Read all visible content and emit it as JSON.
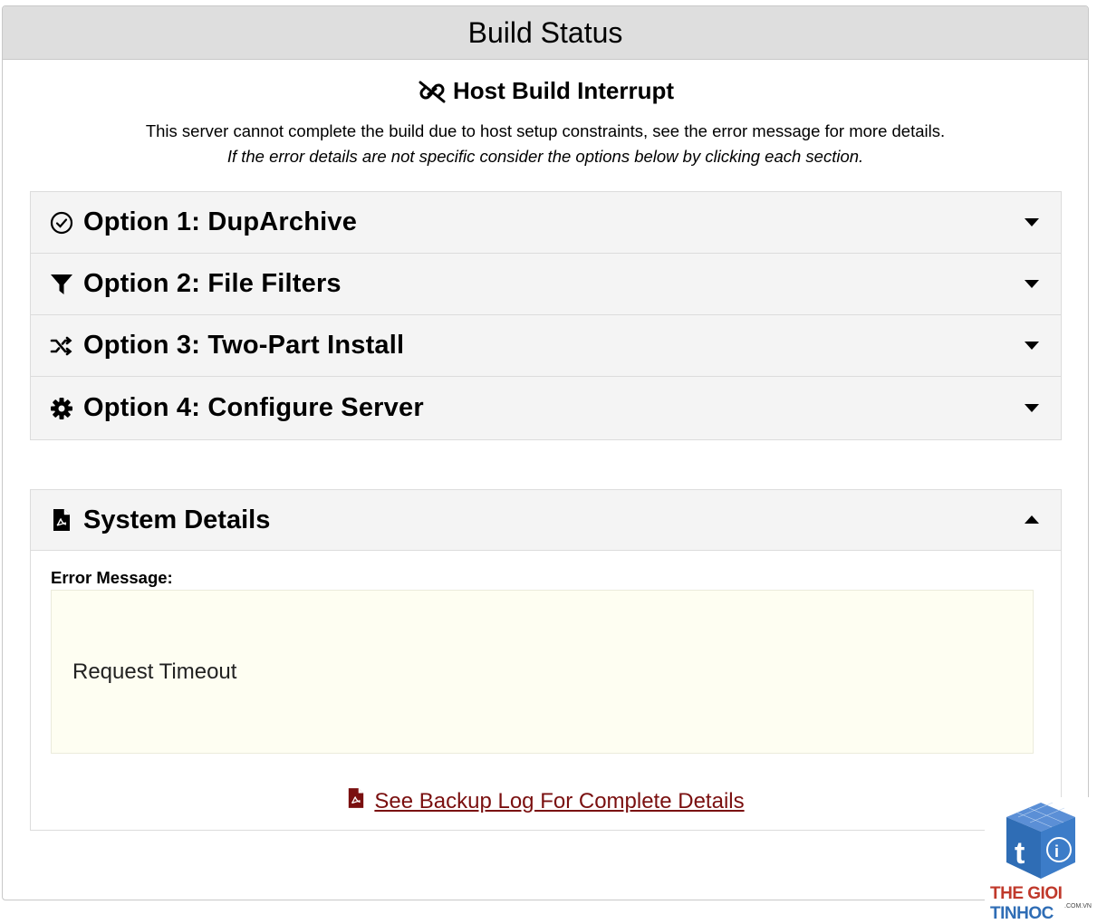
{
  "header": {
    "title": "Build Status"
  },
  "interrupt": {
    "title": "Host Build Interrupt",
    "description": "This server cannot complete the build due to host setup constraints, see the error message for more details.",
    "hint": "If the error details are not specific consider the options below by clicking each section."
  },
  "options": [
    {
      "label": "Option 1: DupArchive",
      "icon": "check-circle-icon"
    },
    {
      "label": "Option 2: File Filters",
      "icon": "filter-icon"
    },
    {
      "label": "Option 3: Two-Part Install",
      "icon": "shuffle-icon"
    },
    {
      "label": "Option 4: Configure Server",
      "icon": "gear-icon"
    }
  ],
  "details": {
    "title": "System Details",
    "error_label": "Error Message:",
    "error_message": "Request Timeout",
    "log_link": "See Backup Log For Complete Details"
  },
  "watermark": {
    "brand_a": "THE GIOI",
    "brand_b": "TINHOC",
    "sub": ".COM.VN"
  },
  "colors": {
    "link": "#7a0f0f",
    "header_bg": "#dedede",
    "error_bg": "#fefef2"
  }
}
